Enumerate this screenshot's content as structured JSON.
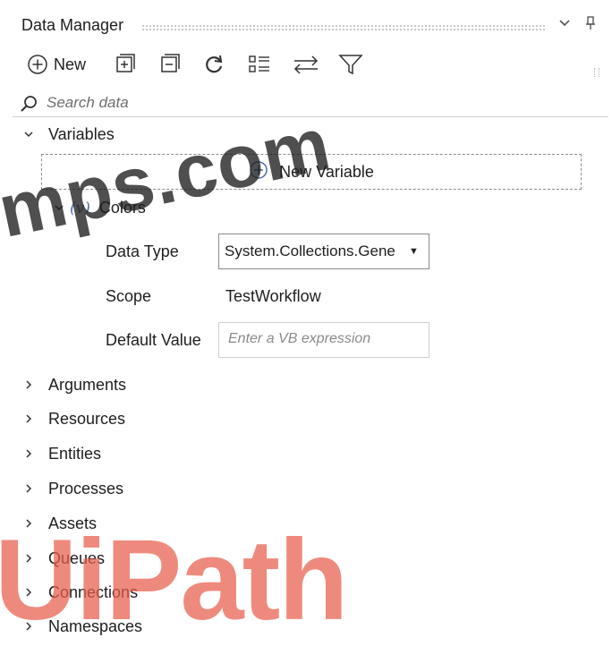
{
  "panel": {
    "title": "Data Manager",
    "dropdown_icon": "chevron-down-icon",
    "pin_icon": "pin-icon"
  },
  "toolbar": {
    "new_label": "New",
    "icons": [
      "add-circle-icon",
      "expand-all-icon",
      "collapse-all-icon",
      "refresh-icon",
      "view-list-icon",
      "swap-icon",
      "filter-icon"
    ]
  },
  "search": {
    "placeholder": "Search data",
    "icon": "search-icon"
  },
  "tree": {
    "variables_label": "Variables",
    "new_variable_label": "New Variable",
    "variable": {
      "type_glyph": "(v)",
      "name": "Colors",
      "data_type_label": "Data Type",
      "data_type_value": "System.Collections.Gene",
      "scope_label": "Scope",
      "scope_value": "TestWorkflow",
      "default_value_label": "Default Value",
      "default_value_placeholder": "Enter a VB expression"
    },
    "sections": [
      "Arguments",
      "Resources",
      "Entities",
      "Processes",
      "Assets",
      "Queues",
      "Connections",
      "Namespaces"
    ]
  },
  "watermarks": {
    "top": "mps.com",
    "bottom": "UiPath"
  },
  "colors": {
    "accent": "#4a6aa8",
    "watermark_red": "#e85d4b"
  }
}
